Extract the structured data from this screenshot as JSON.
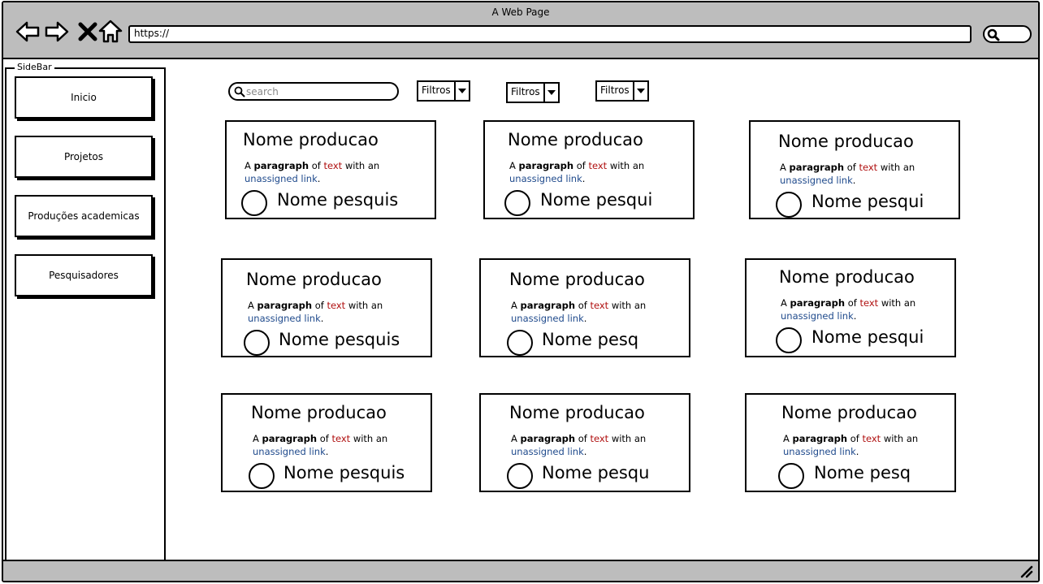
{
  "window": {
    "title": "A Web Page"
  },
  "browser": {
    "url": "https://",
    "nav_icons": [
      "back-arrow-icon",
      "forward-arrow-icon",
      "close-icon",
      "home-icon"
    ],
    "search_icon": "search-icon"
  },
  "sidebar": {
    "legend": "SideBar",
    "items": [
      {
        "label": "Inicio"
      },
      {
        "label": "Projetos"
      },
      {
        "label": "Produções academicas"
      },
      {
        "label": "Pesquisadores"
      }
    ]
  },
  "toolbar": {
    "search_placeholder": "search",
    "filters": [
      {
        "label": "Filtros"
      },
      {
        "label": "Filtros"
      },
      {
        "label": "Filtros"
      }
    ]
  },
  "cards": [
    {
      "title": "Nome producao",
      "para_a": "A",
      "para_bold": "paragraph",
      "para_of": "of",
      "para_red": "text",
      "para_rest": "with an",
      "para_link": "unassigned link",
      "para_end": ".",
      "author": "Nome pesquis"
    },
    {
      "title": "Nome producao",
      "para_a": "A",
      "para_bold": "paragraph",
      "para_of": "of",
      "para_red": "text",
      "para_rest": "with an",
      "para_link": "unassigned link",
      "para_end": ".",
      "author": "Nome pesqui"
    },
    {
      "title": "Nome producao",
      "para_a": "A",
      "para_bold": "paragraph",
      "para_of": "of",
      "para_red": "text",
      "para_rest": "with an",
      "para_link": "unassigned link",
      "para_end": ".",
      "author": "Nome pesqui"
    },
    {
      "title": "Nome producao",
      "para_a": "A",
      "para_bold": "paragraph",
      "para_of": "of",
      "para_red": "text",
      "para_rest": "with an",
      "para_link": "unassigned link",
      "para_end": ".",
      "author": "Nome pesquis"
    },
    {
      "title": "Nome producao",
      "para_a": "A",
      "para_bold": "paragraph",
      "para_of": "of",
      "para_red": "text",
      "para_rest": "with an",
      "para_link": "unassigned link",
      "para_end": ".",
      "author": "Nome pesq"
    },
    {
      "title": "Nome producao",
      "para_a": "A",
      "para_bold": "paragraph",
      "para_of": "of",
      "para_red": "text",
      "para_rest": "with an",
      "para_link": "unassigned link",
      "para_end": ".",
      "author": "Nome pesqui"
    },
    {
      "title": "Nome producao",
      "para_a": "A",
      "para_bold": "paragraph",
      "para_of": "of",
      "para_red": "text",
      "para_rest": "with an",
      "para_link": "unassigned link",
      "para_end": ".",
      "author": "Nome pesquis"
    },
    {
      "title": "Nome producao",
      "para_a": "A",
      "para_bold": "paragraph",
      "para_of": "of",
      "para_red": "text",
      "para_rest": "with an",
      "para_link": "unassigned link",
      "para_end": ".",
      "author": "Nome pesqu"
    },
    {
      "title": "Nome producao",
      "para_a": "A",
      "para_bold": "paragraph",
      "para_of": "of",
      "para_red": "text",
      "para_rest": "with an",
      "para_link": "unassigned link",
      "para_end": ".",
      "author": "Nome pesq"
    }
  ],
  "colors": {
    "chrome": "#bdbdbd",
    "text_red": "#b01010",
    "link_blue": "#1f4a8c"
  }
}
